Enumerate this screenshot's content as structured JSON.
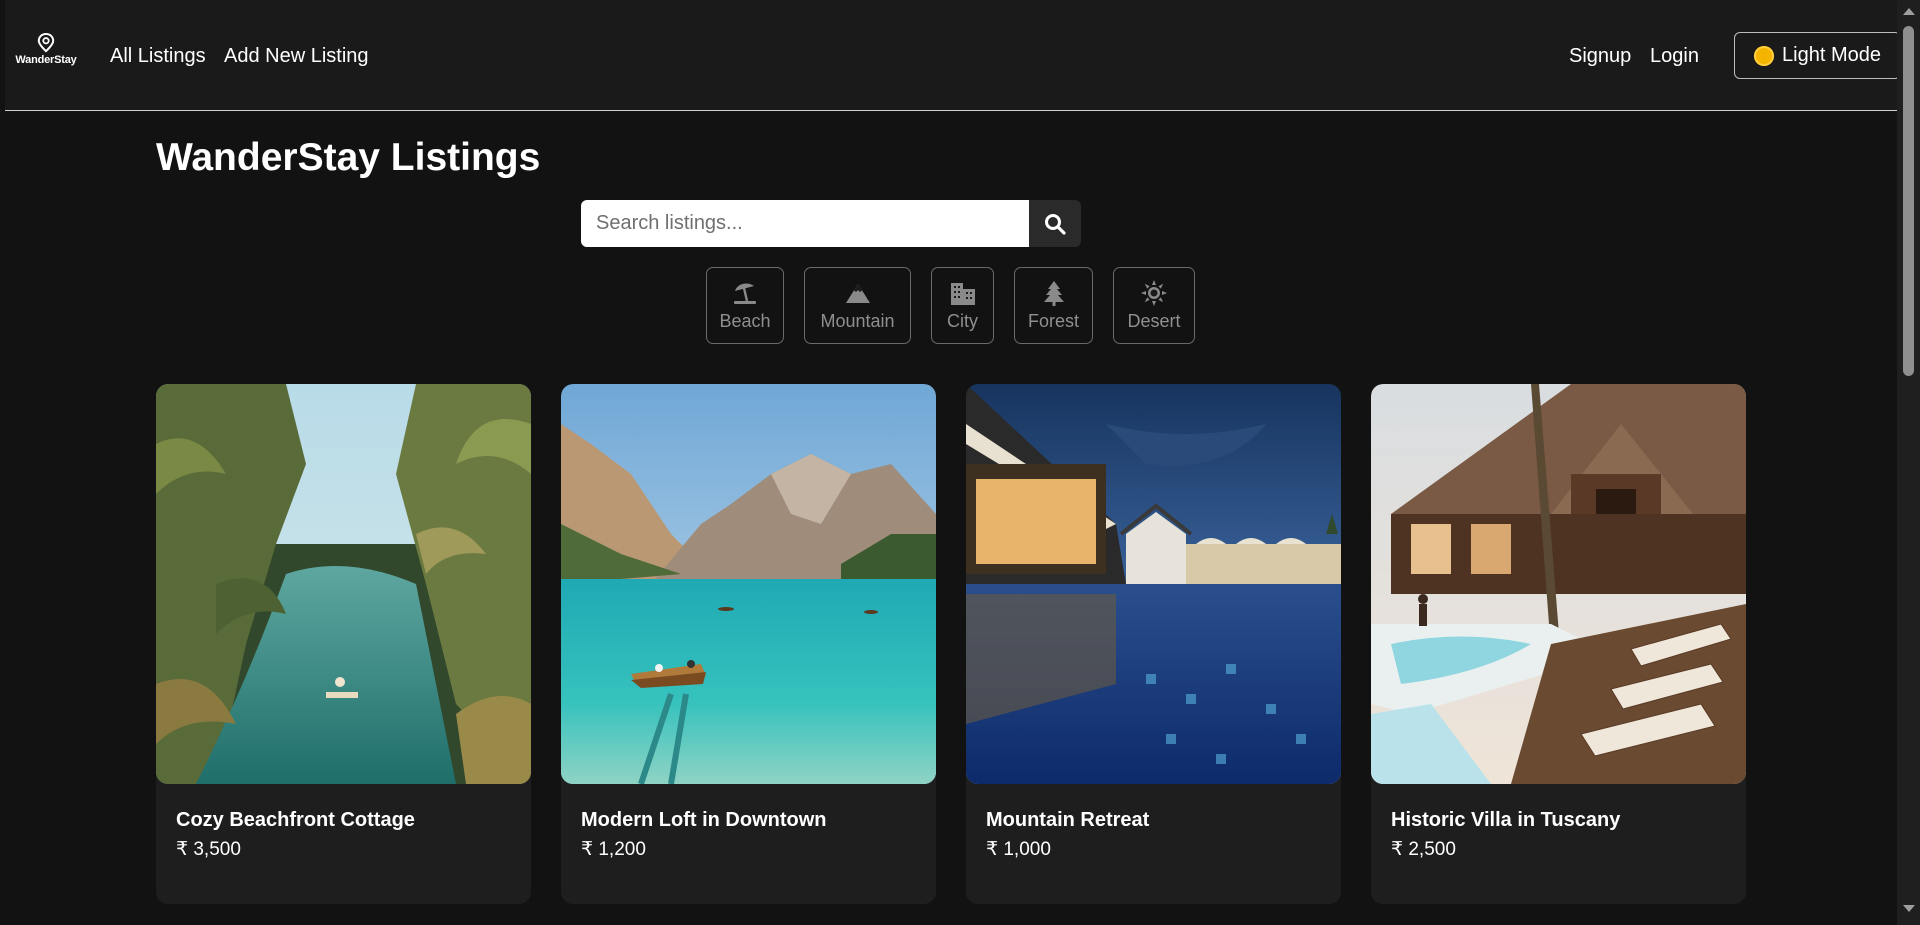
{
  "navbar": {
    "brand": "WanderStay",
    "links": [
      "All Listings",
      "Add New Listing"
    ],
    "signup": "Signup",
    "login": "Login",
    "theme_toggle": "Light Mode"
  },
  "page": {
    "title": "WanderStay Listings"
  },
  "search": {
    "placeholder": "Search listings..."
  },
  "filters": [
    {
      "label": "Beach",
      "icon": "umbrella-beach-icon"
    },
    {
      "label": "Mountain",
      "icon": "mountain-icon"
    },
    {
      "label": "City",
      "icon": "city-icon"
    },
    {
      "label": "Forest",
      "icon": "tree-icon"
    },
    {
      "label": "Desert",
      "icon": "sun-icon"
    }
  ],
  "listings": [
    {
      "title": "Cozy Beachfront Cottage",
      "price": "₹ 3,500"
    },
    {
      "title": "Modern Loft in Downtown",
      "price": "₹ 1,200"
    },
    {
      "title": "Mountain Retreat",
      "price": "₹ 1,000"
    },
    {
      "title": "Historic Villa in Tuscany",
      "price": "₹ 2,500"
    }
  ],
  "colors": {
    "background": "#121212",
    "navbar": "#1a1a1a",
    "card": "#1e1e1e",
    "accent_sun": "#f5b400"
  }
}
